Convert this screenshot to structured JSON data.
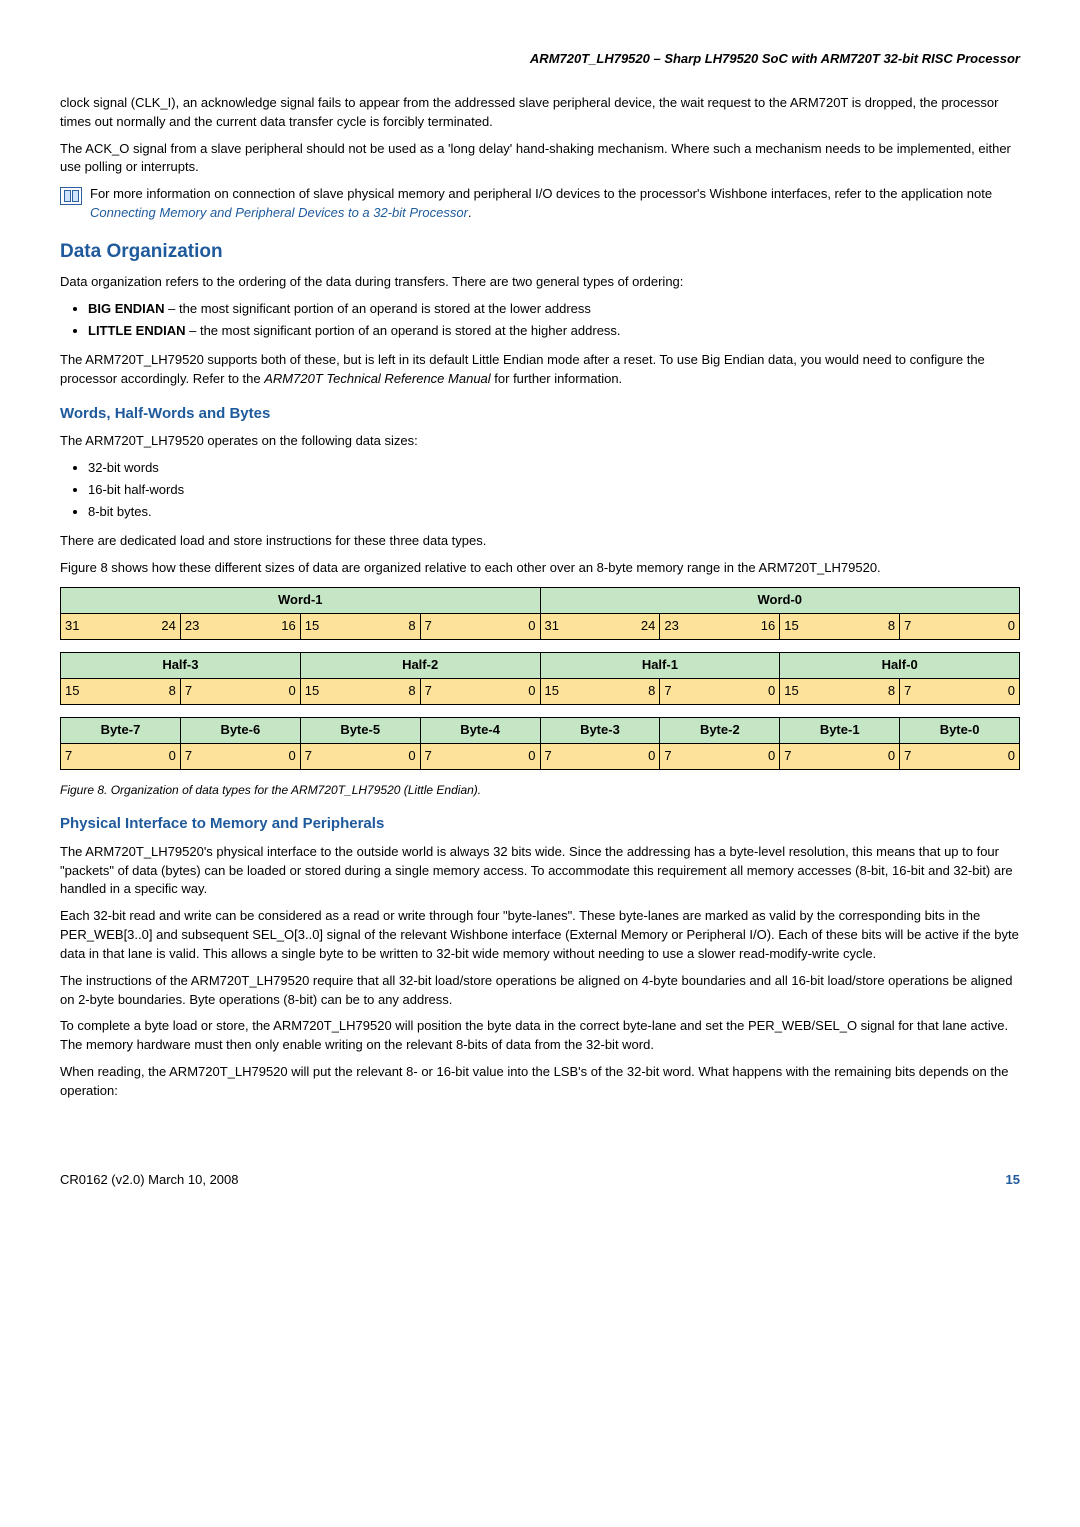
{
  "header": {
    "title": "ARM720T_LH79520 – Sharp LH79520 SoC with ARM720T 32-bit RISC Processor"
  },
  "intro": {
    "p1": "clock signal (CLK_I), an acknowledge signal fails to appear from the addressed slave peripheral device, the wait request to the ARM720T is dropped, the processor times out normally and the current data transfer cycle is forcibly terminated.",
    "p2": "The ACK_O signal from a slave peripheral should not be used as a 'long delay' hand-shaking mechanism. Where such a mechanism needs to be implemented, either use polling or interrupts.",
    "note_a": "For more information on connection of slave physical memory and peripheral I/O devices to the processor's Wishbone interfaces, refer to the application note ",
    "note_link": "Connecting Memory and Peripheral Devices to a 32-bit Processor",
    "note_b": "."
  },
  "data_org": {
    "title": "Data Organization",
    "p1": "Data organization refers to the ordering of the data during transfers. There are two general types of ordering:",
    "bullet1_label": "BIG ENDIAN",
    "bullet1_text": " – the most significant portion of an operand is stored at the lower address",
    "bullet2_label": "LITTLE ENDIAN",
    "bullet2_text": " – the most significant portion of an operand is stored at the higher address.",
    "p2a": "The ARM720T_LH79520 supports both of these, but is left in its default Little Endian mode after a reset. To use Big Endian data, you would need to configure the processor accordingly. Refer to the ",
    "p2_em": "ARM720T Technical Reference Manual",
    "p2b": " for further information."
  },
  "words": {
    "title": "Words, Half-Words and Bytes",
    "p1": "The ARM720T_LH79520 operates on the following data sizes:",
    "b1": "32-bit words",
    "b2": "16-bit half-words",
    "b3": "8-bit bytes.",
    "p2": "There are dedicated load and store instructions for these three data types.",
    "p3": "Figure 8 shows how these different sizes of data are organized relative to each other over an 8-byte memory range in the ARM720T_LH79520."
  },
  "table_word": {
    "h1": "Word-1",
    "h0": "Word-0",
    "c1": [
      "31",
      "24",
      "23",
      "16",
      "15",
      "8",
      "7",
      "0"
    ],
    "c0": [
      "31",
      "24",
      "23",
      "16",
      "15",
      "8",
      "7",
      "0"
    ]
  },
  "table_half": {
    "h3": "Half-3",
    "h2": "Half-2",
    "h1": "Half-1",
    "h0": "Half-0",
    "c": [
      "15",
      "8",
      "7",
      "0"
    ]
  },
  "table_byte": {
    "h7": "Byte-7",
    "h6": "Byte-6",
    "h5": "Byte-5",
    "h4": "Byte-4",
    "h3": "Byte-3",
    "h2": "Byte-2",
    "h1": "Byte-1",
    "h0": "Byte-0",
    "c": [
      "7",
      "0"
    ]
  },
  "figcaption": "Figure 8. Organization of data types for the ARM720T_LH79520 (Little Endian).",
  "phys": {
    "title": "Physical Interface to Memory and Peripherals",
    "p1": "The ARM720T_LH79520's physical interface to the outside world is always 32 bits wide. Since the addressing has a byte-level resolution, this means that up to four \"packets\" of data (bytes) can be loaded or stored during a single memory access. To accommodate this requirement all memory accesses (8-bit, 16-bit and 32-bit) are handled in a specific way.",
    "p2": "Each 32-bit read and write can be considered as a read or write through four \"byte-lanes\". These byte-lanes are marked as valid by the corresponding bits in the PER_WEB[3..0] and subsequent  SEL_O[3..0] signal of the relevant Wishbone interface (External Memory or Peripheral I/O). Each of these bits will be active if the byte data in that lane is valid. This allows a single byte to be written to 32-bit wide memory without needing to use a slower read-modify-write cycle.",
    "p3": "The instructions of the ARM720T_LH79520 require that all 32-bit load/store operations be aligned on 4-byte boundaries and all 16-bit load/store operations be aligned on 2-byte boundaries. Byte operations (8-bit) can be to any address.",
    "p4": "To complete a byte load or store, the ARM720T_LH79520 will position the byte data in the correct byte-lane and set the PER_WEB/SEL_O signal for that lane active. The memory hardware must then only enable writing on the relevant 8-bits of data from the 32-bit word.",
    "p5": "When reading, the ARM720T_LH79520 will put the relevant 8- or 16-bit value into the LSB's of the 32-bit word. What happens with the remaining bits depends on the operation:"
  },
  "footer": {
    "left": "CR0162 (v2.0) March 10, 2008",
    "page": "15"
  }
}
